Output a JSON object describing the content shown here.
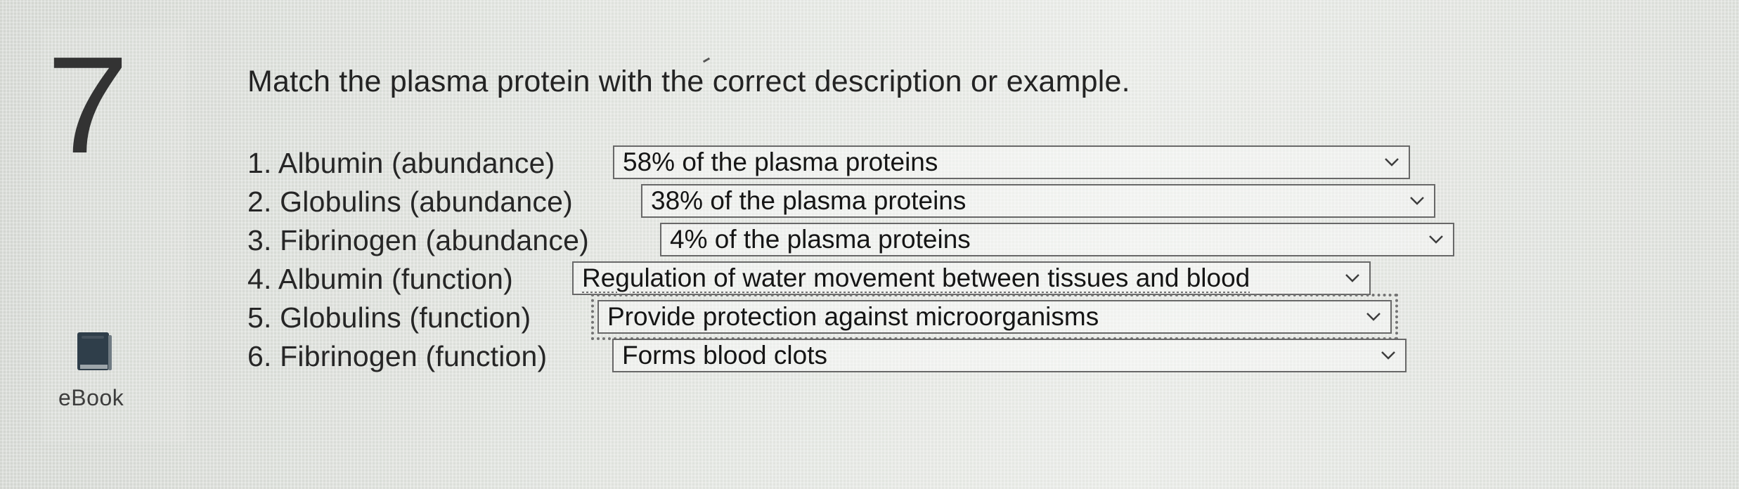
{
  "question": {
    "number": "7",
    "prompt": "Match the plasma protein with the correct description or example."
  },
  "resources": {
    "ebook_label": "eBook",
    "icon": "book-icon"
  },
  "matching_items": [
    {
      "label": "1. Albumin (abundance)",
      "selected_value": "58% of the plasma proteins",
      "icon": "chevron-down-icon"
    },
    {
      "label": "2. Globulins (abundance)",
      "selected_value": "38% of the plasma proteins",
      "icon": "chevron-down-icon"
    },
    {
      "label": "3. Fibrinogen (abundance)",
      "selected_value": "4% of the plasma proteins",
      "icon": "chevron-down-icon"
    },
    {
      "label": "4. Albumin (function)",
      "selected_value": "Regulation of water movement between tissues and blood",
      "icon": "chevron-down-icon"
    },
    {
      "label": "5. Globulins (function)",
      "selected_value": "Provide protection against microorganisms",
      "icon": "chevron-down-icon"
    },
    {
      "label": "6. Fibrinogen (function)",
      "selected_value": "Forms blood clots",
      "icon": "chevron-down-icon"
    }
  ],
  "colors": {
    "text": "#262626",
    "border": "#686868",
    "ebook_icon": "#2f3e4a"
  }
}
